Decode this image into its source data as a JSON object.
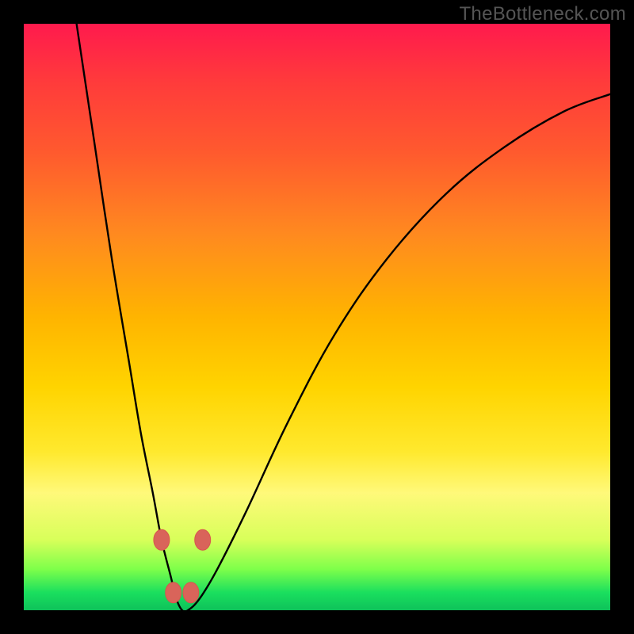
{
  "watermark": "TheBottleneck.com",
  "chart_data": {
    "type": "line",
    "title": "",
    "xlabel": "",
    "ylabel": "",
    "xlim": [
      0,
      100
    ],
    "ylim": [
      0,
      100
    ],
    "series": [
      {
        "name": "bottleneck-curve",
        "x": [
          9,
          12,
          15,
          18,
          20,
          22,
          23.5,
          25,
          26,
          27,
          28,
          30,
          33,
          38,
          45,
          53,
          62,
          72,
          82,
          92,
          100
        ],
        "values": [
          100,
          80,
          60,
          42,
          30,
          20,
          12,
          6,
          2,
          0,
          0,
          2,
          7,
          17,
          32,
          47,
          60,
          71,
          79,
          85,
          88
        ]
      }
    ],
    "markers": [
      {
        "x": 23.5,
        "y": 12
      },
      {
        "x": 25.5,
        "y": 3
      },
      {
        "x": 28.5,
        "y": 3
      },
      {
        "x": 30.5,
        "y": 12
      }
    ],
    "colors": {
      "curve": "#000000",
      "marker": "#d9645a"
    }
  }
}
